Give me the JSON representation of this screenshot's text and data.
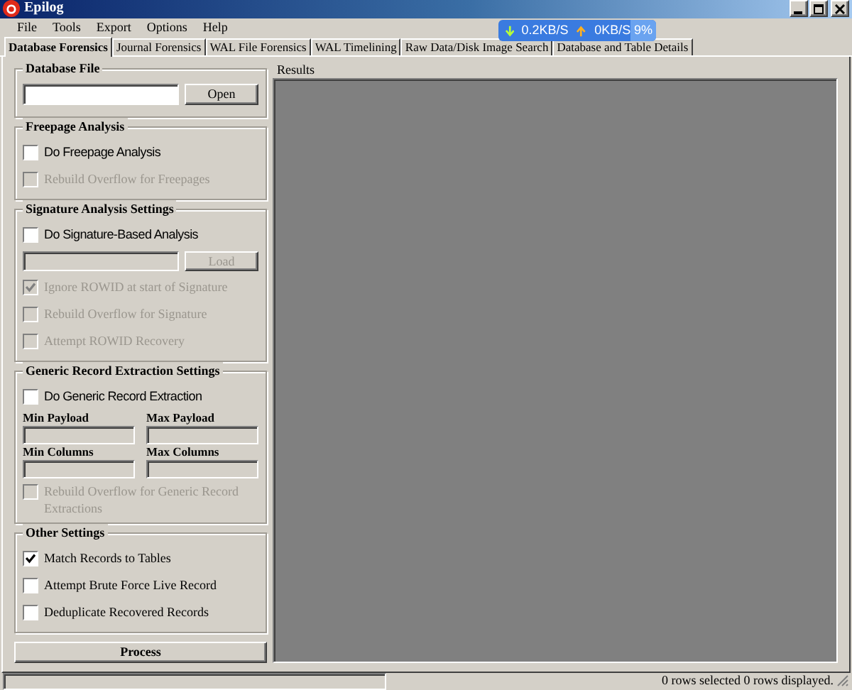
{
  "window": {
    "title": "Epilog"
  },
  "menu": [
    "File",
    "Tools",
    "Export",
    "Options",
    "Help"
  ],
  "net_meter": {
    "download": "0.2KB/S",
    "upload": "0KB/S",
    "percent": "9%"
  },
  "tabs": [
    {
      "label": "Database Forensics",
      "selected": true
    },
    {
      "label": "Journal Forensics",
      "selected": false
    },
    {
      "label": "WAL File Forensics",
      "selected": false
    },
    {
      "label": "WAL Timelining",
      "selected": false
    },
    {
      "label": "Raw Data/Disk Image Search",
      "selected": false
    },
    {
      "label": "Database and Table Details",
      "selected": false
    }
  ],
  "database_file": {
    "title": "Database File",
    "button": "Open"
  },
  "freepage": {
    "title": "Freepage Analysis",
    "options": [
      {
        "label": "Do Freepage Analysis",
        "kind": "main",
        "checked": false,
        "disabled": false
      },
      {
        "label": "Rebuild Overflow for Freepages",
        "kind": "option",
        "checked": false,
        "disabled": true
      }
    ]
  },
  "signature": {
    "title": "Signature Analysis Settings",
    "main": {
      "label": "Do Signature-Based Analysis",
      "kind": "main",
      "checked": false,
      "disabled": false
    },
    "button": "Load",
    "button_disabled": true,
    "options": [
      {
        "label": "Ignore ROWID at start of Signature",
        "kind": "option",
        "checked": true,
        "disabled": true
      },
      {
        "label": "Rebuild Overflow for Signature",
        "kind": "option",
        "checked": false,
        "disabled": true
      },
      {
        "label": "Attempt ROWID Recovery",
        "kind": "option",
        "checked": false,
        "disabled": true
      }
    ]
  },
  "generic": {
    "title": "Generic Record Extraction Settings",
    "main": {
      "label": "Do Generic Record Extraction",
      "kind": "main",
      "checked": false,
      "disabled": false
    },
    "fields": [
      {
        "label": "Min Payload"
      },
      {
        "label": "Max Payload"
      },
      {
        "label": "Min Columns"
      },
      {
        "label": "Max Columns"
      }
    ],
    "options": [
      {
        "label": "Rebuild Overflow for Generic Record Extractions",
        "kind": "option",
        "checked": false,
        "disabled": true
      }
    ]
  },
  "other": {
    "title": "Other Settings",
    "options": [
      {
        "label": "Match Records to Tables",
        "kind": "option",
        "checked": true,
        "disabled": false
      },
      {
        "label": "Attempt Brute Force Live Record",
        "kind": "option",
        "checked": false,
        "disabled": false
      },
      {
        "label": "Deduplicate Recovered Records",
        "kind": "option",
        "checked": false,
        "disabled": false
      }
    ]
  },
  "process_button": "Process",
  "results": {
    "title": "Results"
  },
  "status_bar": {
    "text": "0 rows selected 0 rows displayed."
  }
}
